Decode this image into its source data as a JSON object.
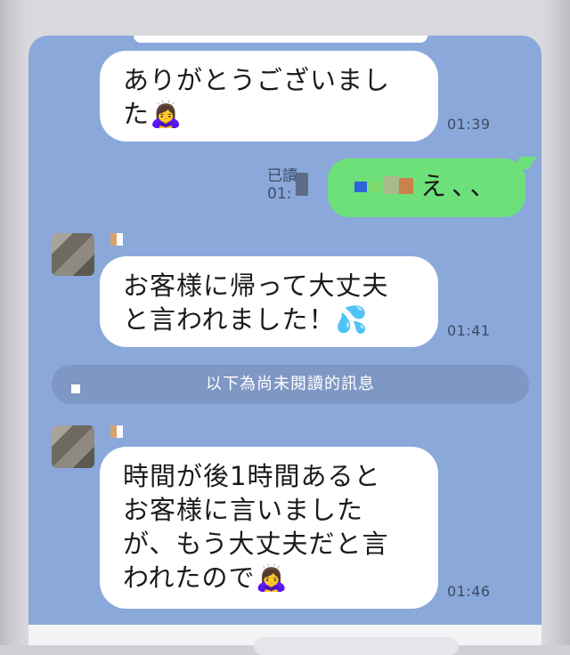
{
  "messages": [
    {
      "text": "ありがとうございまし\nた🙇‍♀️",
      "time": "01:39"
    },
    {
      "text": "お客様に帰って大丈夫\nと言われました！💦",
      "time": "01:41"
    },
    {
      "text": "時間が後1時間あると\nお客様に言いました\nが、もう大丈夫だと言\nわれたので🙇‍♀️",
      "time": "01:46"
    }
  ],
  "sent": {
    "text": "え、、",
    "read_label": "已讀",
    "time": "01:"
  },
  "unread_divider": "以下為尚未閱讀的訊息",
  "colors": {
    "chat_bg": "#8aa8da",
    "bubble_in": "#ffffff",
    "bubble_out": "#6ee07a"
  }
}
